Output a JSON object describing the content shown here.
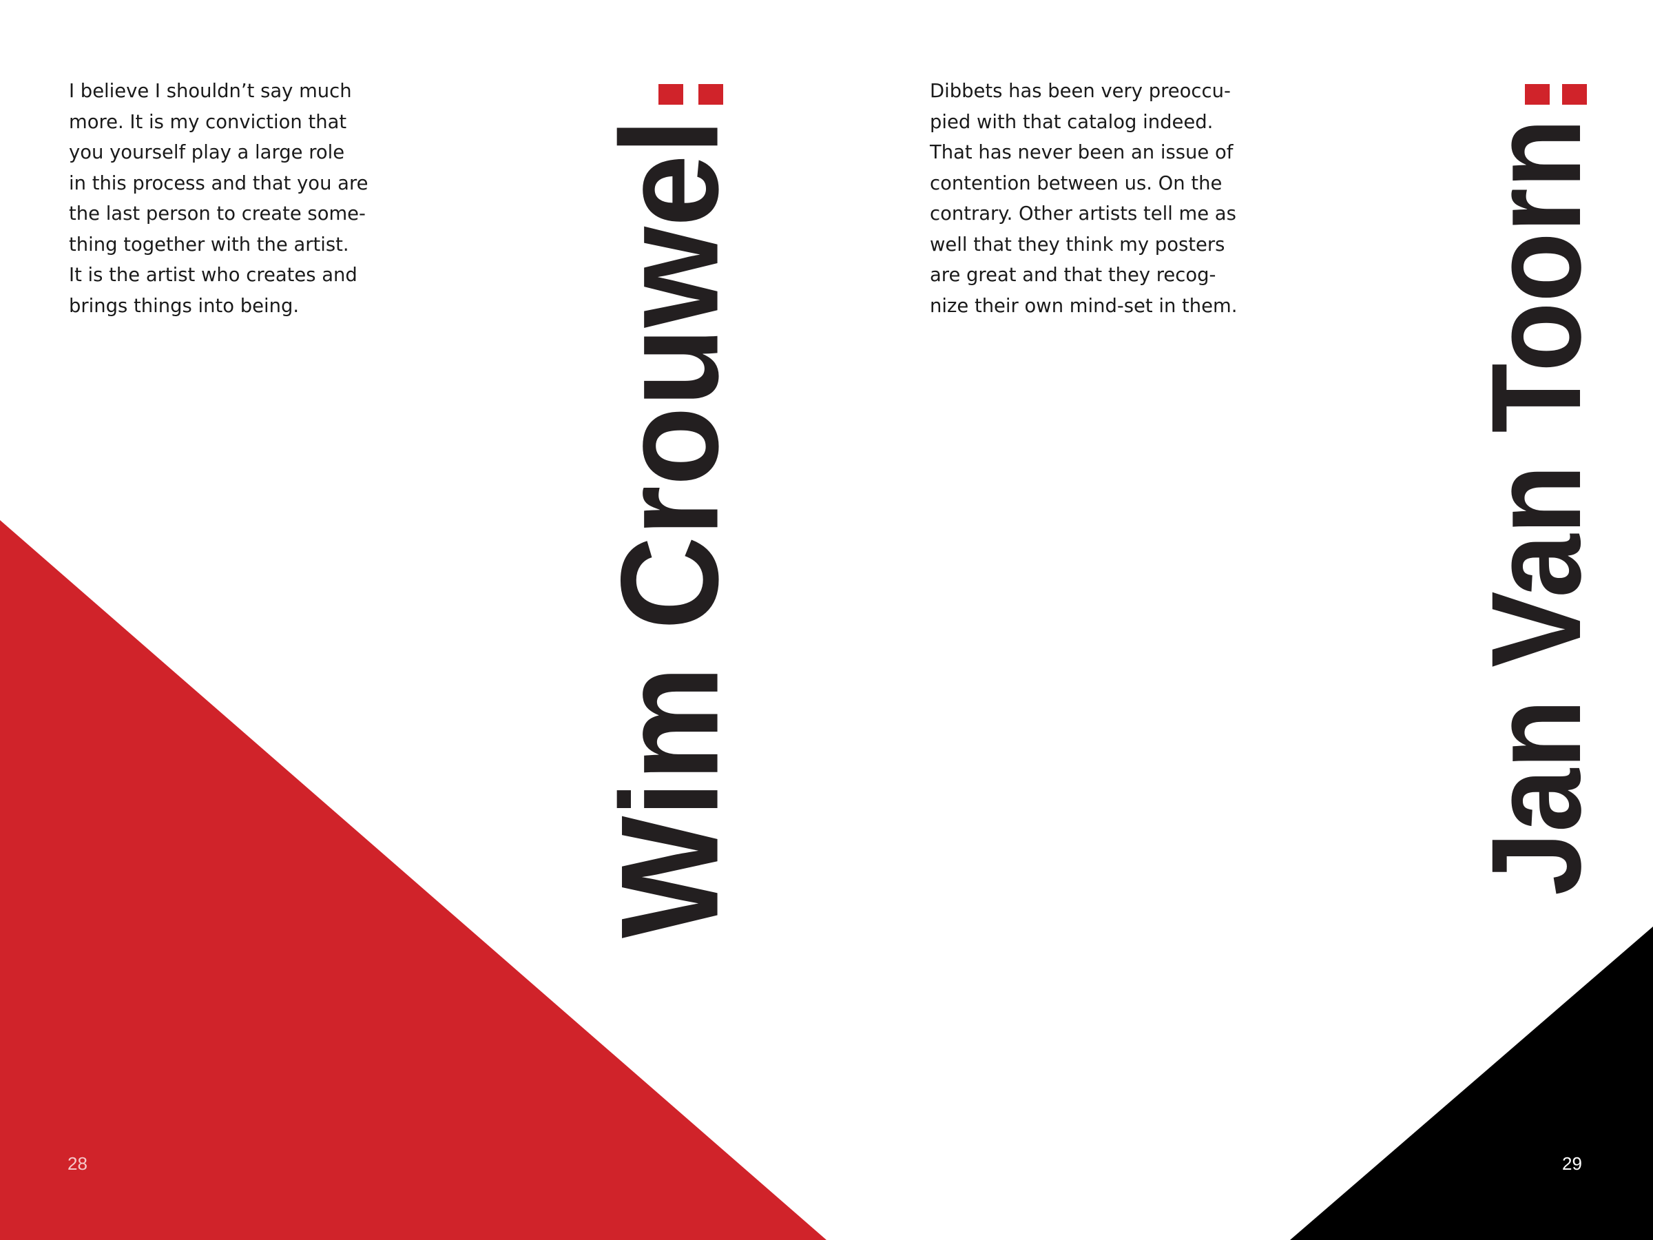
{
  "colors": {
    "accent_red": "#d0232a",
    "black": "#000000",
    "text": "#1a1a1a",
    "name_text": "#231f20",
    "page_number_on_red": "#f6c9cb",
    "page_number_on_black": "#ffffff"
  },
  "left_page": {
    "body_lines": [
      "I believe I shouldn’t say much",
      "more. It is my conviction that",
      "you yourself play a large role",
      "in this process and that you are",
      "the last person to create some-",
      "thing together with the artist.",
      "It is the artist who creates and",
      "brings things into being."
    ],
    "name": "Wim Crouwel",
    "page_number": "28"
  },
  "right_page": {
    "body_lines": [
      "Dibbets has been very preoccu-",
      "pied with that catalog indeed.",
      "That has never been an issue of",
      "contention between us. On the",
      "contrary. Other artists tell me as",
      "well that they think my posters",
      "are great and that they recog-",
      "nize their own mind-set in them."
    ],
    "name": "Jan Van Toorn",
    "page_number": "29"
  }
}
